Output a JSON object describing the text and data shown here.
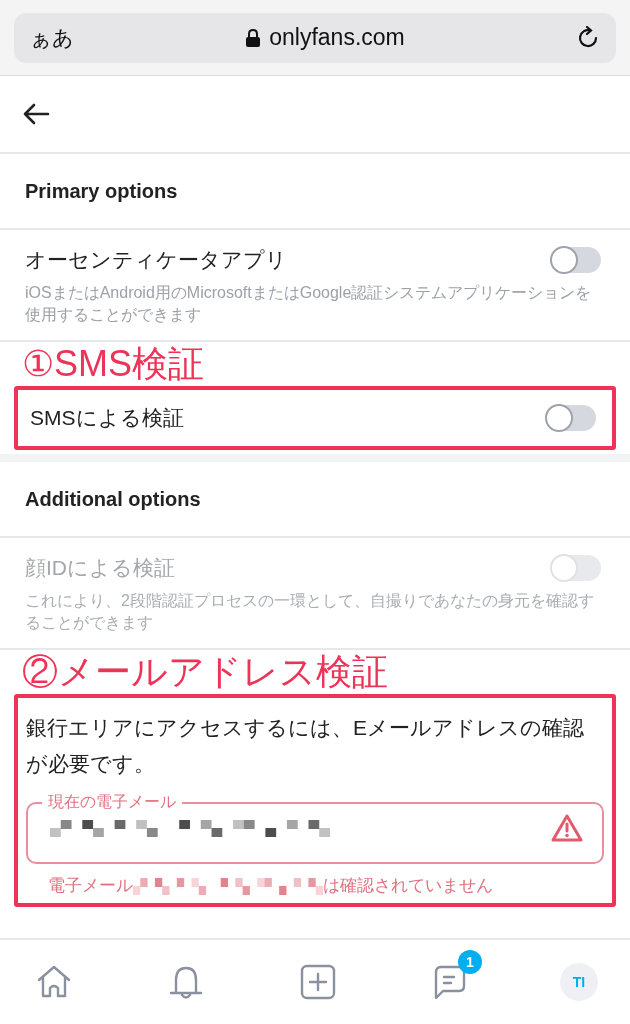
{
  "browser_bar": {
    "text_size": "ぁあ",
    "url": "onlyfans.com"
  },
  "sections": [
    {
      "title": "Primary options",
      "options": [
        {
          "label": "オーセンティケータアプリ",
          "description": "iOSまたはAndroid用のMicrosoftまたはGoogle認証システムアプリケーションを使用することができます",
          "on": false,
          "disabled": false
        },
        {
          "label": "SMSによる検証",
          "on": false,
          "disabled": false,
          "annotation": "①SMS検証"
        }
      ]
    },
    {
      "title": "Additional options",
      "options": [
        {
          "label": "顔IDによる検証",
          "description": "これにより、2段階認証プロセスの一環として、自撮りであなたの身元を確認することができます",
          "on": false,
          "disabled": true
        }
      ]
    }
  ],
  "email_section": {
    "annotation": "②メールアドレス検証",
    "message": "銀行エリアにアクセスするには、Eメールアドレスの確認が必要です。",
    "field_label": "現在の電子メール",
    "error_prefix": "電子メール",
    "error_suffix": "は確認されていません"
  },
  "bottom_nav": [
    {
      "kind": "home"
    },
    {
      "kind": "bell"
    },
    {
      "kind": "add"
    },
    {
      "kind": "chat",
      "badge": "1"
    },
    {
      "kind": "avatar",
      "initials": "TI"
    }
  ]
}
